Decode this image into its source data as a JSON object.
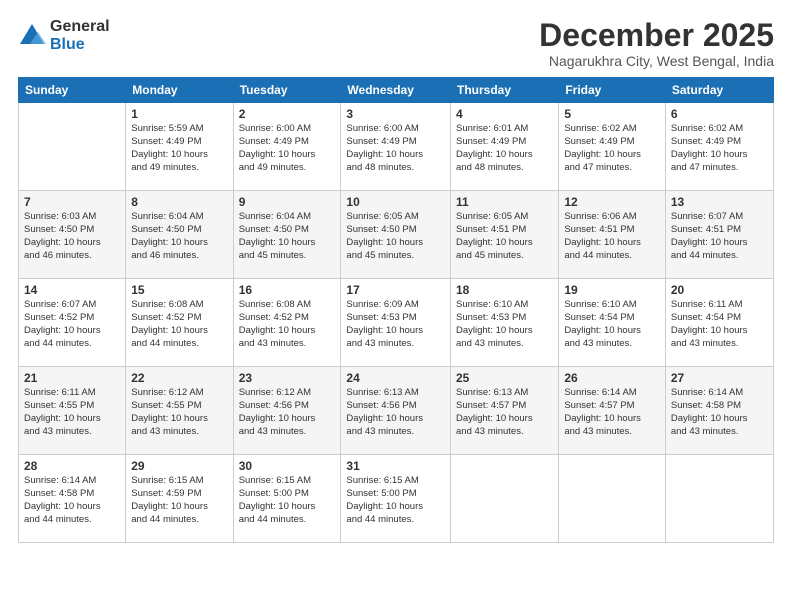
{
  "logo": {
    "general": "General",
    "blue": "Blue"
  },
  "header": {
    "month": "December 2025",
    "location": "Nagarukhra City, West Bengal, India"
  },
  "weekdays": [
    "Sunday",
    "Monday",
    "Tuesday",
    "Wednesday",
    "Thursday",
    "Friday",
    "Saturday"
  ],
  "weeks": [
    [
      {
        "day": "",
        "info": ""
      },
      {
        "day": "1",
        "info": "Sunrise: 5:59 AM\nSunset: 4:49 PM\nDaylight: 10 hours\nand 49 minutes."
      },
      {
        "day": "2",
        "info": "Sunrise: 6:00 AM\nSunset: 4:49 PM\nDaylight: 10 hours\nand 49 minutes."
      },
      {
        "day": "3",
        "info": "Sunrise: 6:00 AM\nSunset: 4:49 PM\nDaylight: 10 hours\nand 48 minutes."
      },
      {
        "day": "4",
        "info": "Sunrise: 6:01 AM\nSunset: 4:49 PM\nDaylight: 10 hours\nand 48 minutes."
      },
      {
        "day": "5",
        "info": "Sunrise: 6:02 AM\nSunset: 4:49 PM\nDaylight: 10 hours\nand 47 minutes."
      },
      {
        "day": "6",
        "info": "Sunrise: 6:02 AM\nSunset: 4:49 PM\nDaylight: 10 hours\nand 47 minutes."
      }
    ],
    [
      {
        "day": "7",
        "info": "Sunrise: 6:03 AM\nSunset: 4:50 PM\nDaylight: 10 hours\nand 46 minutes."
      },
      {
        "day": "8",
        "info": "Sunrise: 6:04 AM\nSunset: 4:50 PM\nDaylight: 10 hours\nand 46 minutes."
      },
      {
        "day": "9",
        "info": "Sunrise: 6:04 AM\nSunset: 4:50 PM\nDaylight: 10 hours\nand 45 minutes."
      },
      {
        "day": "10",
        "info": "Sunrise: 6:05 AM\nSunset: 4:50 PM\nDaylight: 10 hours\nand 45 minutes."
      },
      {
        "day": "11",
        "info": "Sunrise: 6:05 AM\nSunset: 4:51 PM\nDaylight: 10 hours\nand 45 minutes."
      },
      {
        "day": "12",
        "info": "Sunrise: 6:06 AM\nSunset: 4:51 PM\nDaylight: 10 hours\nand 44 minutes."
      },
      {
        "day": "13",
        "info": "Sunrise: 6:07 AM\nSunset: 4:51 PM\nDaylight: 10 hours\nand 44 minutes."
      }
    ],
    [
      {
        "day": "14",
        "info": "Sunrise: 6:07 AM\nSunset: 4:52 PM\nDaylight: 10 hours\nand 44 minutes."
      },
      {
        "day": "15",
        "info": "Sunrise: 6:08 AM\nSunset: 4:52 PM\nDaylight: 10 hours\nand 44 minutes."
      },
      {
        "day": "16",
        "info": "Sunrise: 6:08 AM\nSunset: 4:52 PM\nDaylight: 10 hours\nand 43 minutes."
      },
      {
        "day": "17",
        "info": "Sunrise: 6:09 AM\nSunset: 4:53 PM\nDaylight: 10 hours\nand 43 minutes."
      },
      {
        "day": "18",
        "info": "Sunrise: 6:10 AM\nSunset: 4:53 PM\nDaylight: 10 hours\nand 43 minutes."
      },
      {
        "day": "19",
        "info": "Sunrise: 6:10 AM\nSunset: 4:54 PM\nDaylight: 10 hours\nand 43 minutes."
      },
      {
        "day": "20",
        "info": "Sunrise: 6:11 AM\nSunset: 4:54 PM\nDaylight: 10 hours\nand 43 minutes."
      }
    ],
    [
      {
        "day": "21",
        "info": "Sunrise: 6:11 AM\nSunset: 4:55 PM\nDaylight: 10 hours\nand 43 minutes."
      },
      {
        "day": "22",
        "info": "Sunrise: 6:12 AM\nSunset: 4:55 PM\nDaylight: 10 hours\nand 43 minutes."
      },
      {
        "day": "23",
        "info": "Sunrise: 6:12 AM\nSunset: 4:56 PM\nDaylight: 10 hours\nand 43 minutes."
      },
      {
        "day": "24",
        "info": "Sunrise: 6:13 AM\nSunset: 4:56 PM\nDaylight: 10 hours\nand 43 minutes."
      },
      {
        "day": "25",
        "info": "Sunrise: 6:13 AM\nSunset: 4:57 PM\nDaylight: 10 hours\nand 43 minutes."
      },
      {
        "day": "26",
        "info": "Sunrise: 6:14 AM\nSunset: 4:57 PM\nDaylight: 10 hours\nand 43 minutes."
      },
      {
        "day": "27",
        "info": "Sunrise: 6:14 AM\nSunset: 4:58 PM\nDaylight: 10 hours\nand 43 minutes."
      }
    ],
    [
      {
        "day": "28",
        "info": "Sunrise: 6:14 AM\nSunset: 4:58 PM\nDaylight: 10 hours\nand 44 minutes."
      },
      {
        "day": "29",
        "info": "Sunrise: 6:15 AM\nSunset: 4:59 PM\nDaylight: 10 hours\nand 44 minutes."
      },
      {
        "day": "30",
        "info": "Sunrise: 6:15 AM\nSunset: 5:00 PM\nDaylight: 10 hours\nand 44 minutes."
      },
      {
        "day": "31",
        "info": "Sunrise: 6:15 AM\nSunset: 5:00 PM\nDaylight: 10 hours\nand 44 minutes."
      },
      {
        "day": "",
        "info": ""
      },
      {
        "day": "",
        "info": ""
      },
      {
        "day": "",
        "info": ""
      }
    ]
  ]
}
